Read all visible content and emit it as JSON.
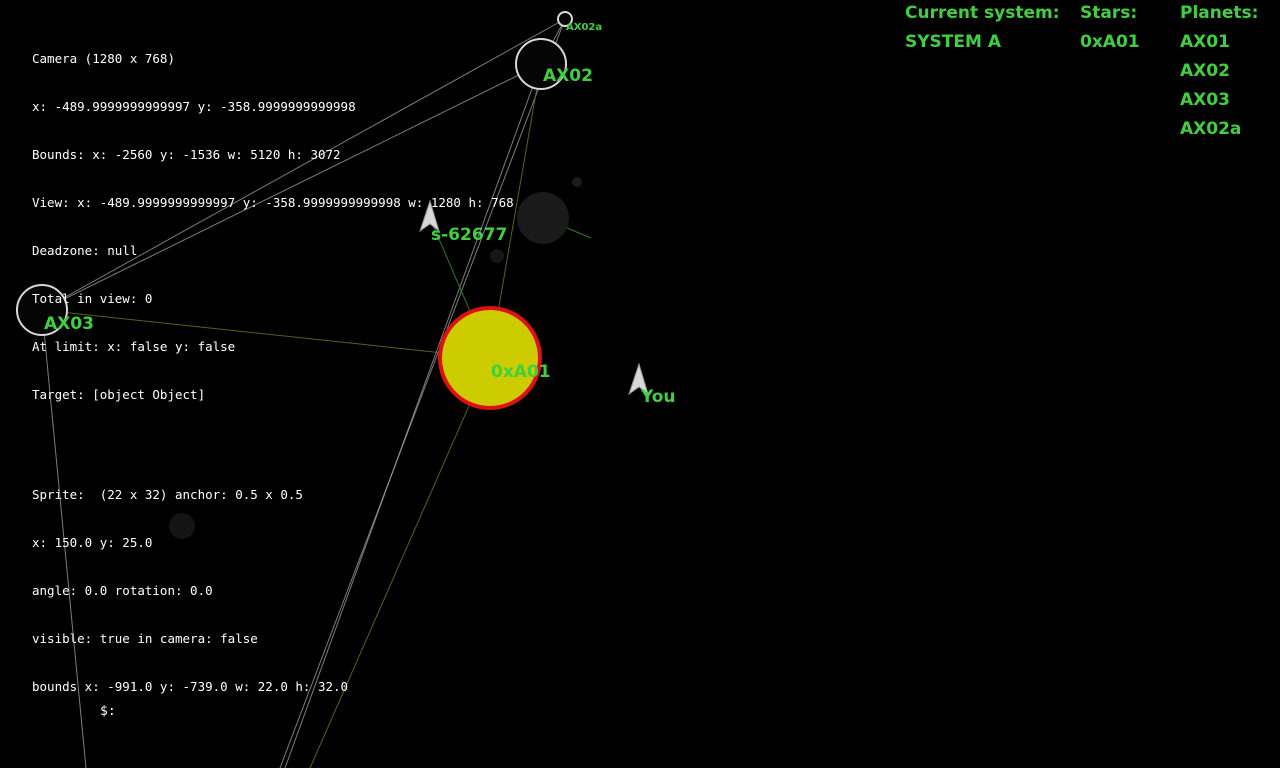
{
  "debug": {
    "camera": "Camera (1280 x 768)",
    "camera_xy": "x: -489.9999999999997 y: -358.9999999999998",
    "bounds": "Bounds: x: -2560 y: -1536 w: 5120 h: 3072",
    "view": "View: x: -489.9999999999997 y: -358.9999999999998 w: 1280 h: 768",
    "deadzone": "Deadzone: null",
    "total_in_view": "Total in view: 0",
    "at_limit": "At limit: x: false y: false",
    "target": "Target: [object Object]",
    "sprite": "Sprite:  (22 x 32) anchor: 0.5 x 0.5",
    "sprite_xy": "x: 150.0 y: 25.0",
    "angle": "angle: 0.0 rotation: 0.0",
    "visible": "visible: true in camera: false",
    "sprite_bounds": "bounds x: -991.0 y: -739.0 w: 22.0 h: 32.0"
  },
  "hud": {
    "current_system_label": "Current system:",
    "current_system_value": "SYSTEM A",
    "stars_label": "Stars:",
    "stars": [
      "0xA01"
    ],
    "planets_label": "Planets:",
    "planets": [
      "AX01",
      "AX02",
      "AX03",
      "AX02a"
    ]
  },
  "scene": {
    "star_label": "0xA01",
    "planet_ax02_label": "AX02",
    "planet_ax02a_label": "AX02a",
    "planet_ax03_label": "AX03",
    "ship_other_label": "s-62677",
    "ship_player_label": "You"
  },
  "prompt": "$:",
  "colors": {
    "background": "#000000",
    "label_green": "#3fd03f",
    "star_fill": "#cccc00",
    "star_ring": "#dd1111",
    "orbit_line": "#bbbbbb",
    "debug_text": "#ffffff"
  }
}
